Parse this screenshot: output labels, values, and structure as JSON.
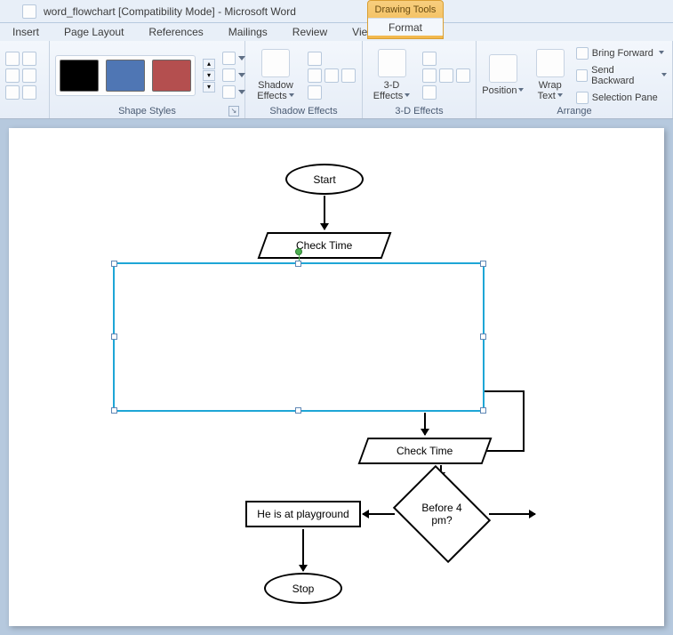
{
  "window": {
    "title": "word_flowchart [Compatibility Mode] - Microsoft Word",
    "contextual_title": "Drawing Tools",
    "contextual_tab": "Format"
  },
  "menu": {
    "insert": "Insert",
    "page_layout": "Page Layout",
    "references": "References",
    "mailings": "Mailings",
    "review": "Review",
    "view": "View"
  },
  "ribbon": {
    "shape_styles_label": "Shape Styles",
    "shadow_effects_btn": "Shadow\nEffects",
    "shadow_effects_label": "Shadow Effects",
    "three_d_btn": "3-D\nEffects",
    "three_d_label": "3-D Effects",
    "position_btn": "Position",
    "wrap_text_btn": "Wrap\nText",
    "bring_forward": "Bring Forward",
    "send_backward": "Send Backward",
    "selection_pane": "Selection Pane",
    "arrange_label": "Arrange"
  },
  "flowchart": {
    "start": "Start",
    "check_time_1": "Check Time",
    "check_time_2": "Check Time",
    "playground": "He is at playground",
    "before4": "Before 4 pm?",
    "stop": "Stop"
  }
}
